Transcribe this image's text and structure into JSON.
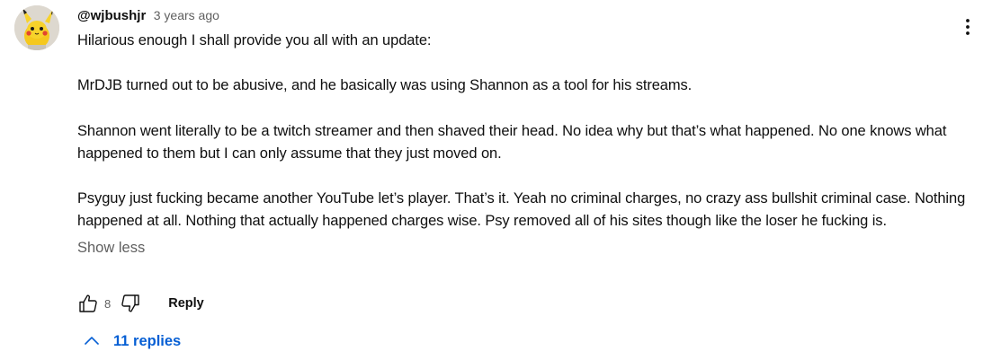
{
  "comment": {
    "author": "@wjbushjr",
    "timestamp": "3 years ago",
    "avatar_icon": "pikachu-avatar",
    "paragraphs": [
      "Hilarious enough I shall provide you all with an update:",
      "MrDJB turned out to be abusive, and he basically was using Shannon as a tool for his streams.",
      "Shannon went literally to be a twitch streamer and then shaved their head. No idea why but that’s what happened. No one knows what happened to them but I can only assume that they just moved on.",
      "Psyguy just fucking became another YouTube let’s player. That’s it. Yeah no criminal charges, no crazy ass bullshit criminal case. Nothing happened at all. Nothing that actually happened charges wise. Psy removed all of his sites though like the loser he fucking is."
    ],
    "show_less_label": "Show less",
    "like_count": "8",
    "reply_label": "Reply",
    "replies_label": "11 replies",
    "icons": {
      "like": "thumbs-up-icon",
      "dislike": "thumbs-down-icon",
      "replies": "chevron-up-icon",
      "menu": "more-vertical-icon"
    },
    "colors": {
      "link_blue": "#065fd4",
      "secondary_text": "#606060"
    }
  }
}
